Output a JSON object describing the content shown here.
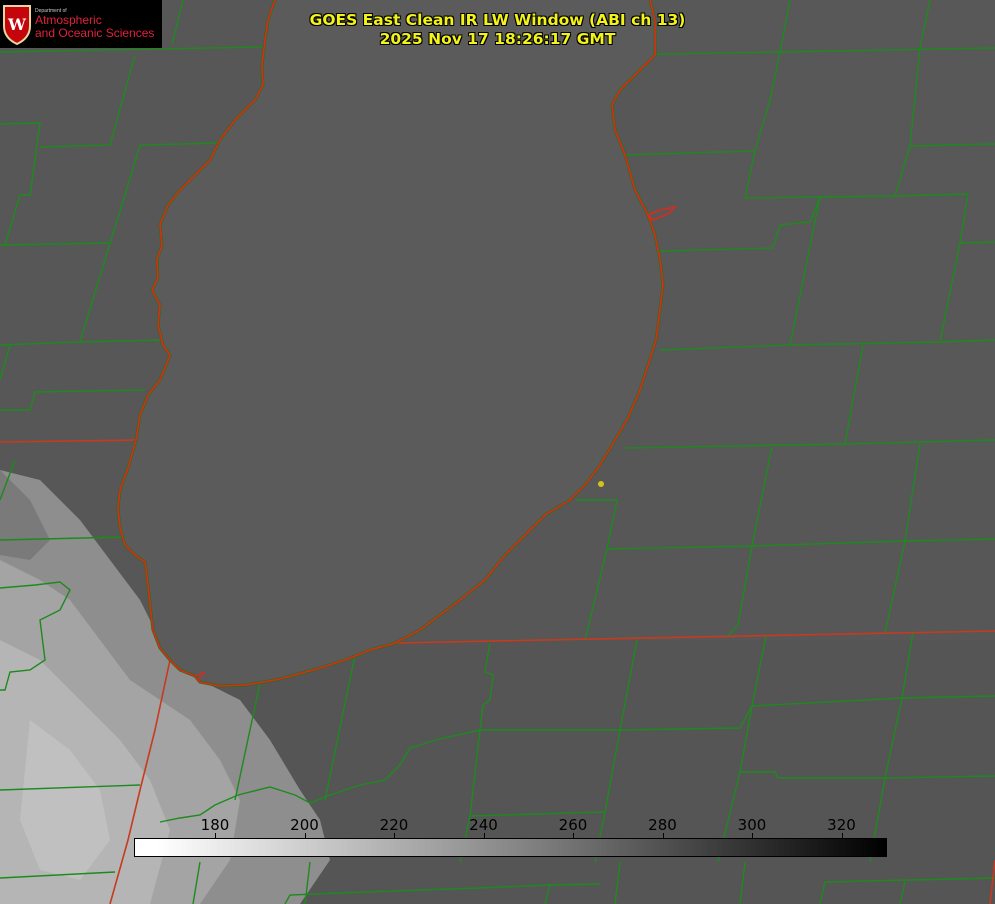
{
  "header": {
    "title_line1": "GOES East Clean IR LW Window (ABI ch 13)",
    "title_line2": "2025 Nov 17 18:26:17 GMT"
  },
  "logo": {
    "crest_letter": "W",
    "department": "Department of",
    "line1": "Atmospheric",
    "line2": "and Oceanic Sciences"
  },
  "colorbar": {
    "ticks": [
      "180",
      "200",
      "220",
      "240",
      "260",
      "280",
      "300",
      "320"
    ],
    "gradient_direction": "white-to-black"
  },
  "colors": {
    "title": "#f3f318",
    "county_lines": "#1e8a1e",
    "state_lines": "#d23a1a",
    "lake_outline": "#e0281a",
    "marker": "#d6c21a",
    "lake_fill": "#5a5a5a",
    "land_fill": "#585858",
    "cloud_fill": "#9a9a9a"
  }
}
